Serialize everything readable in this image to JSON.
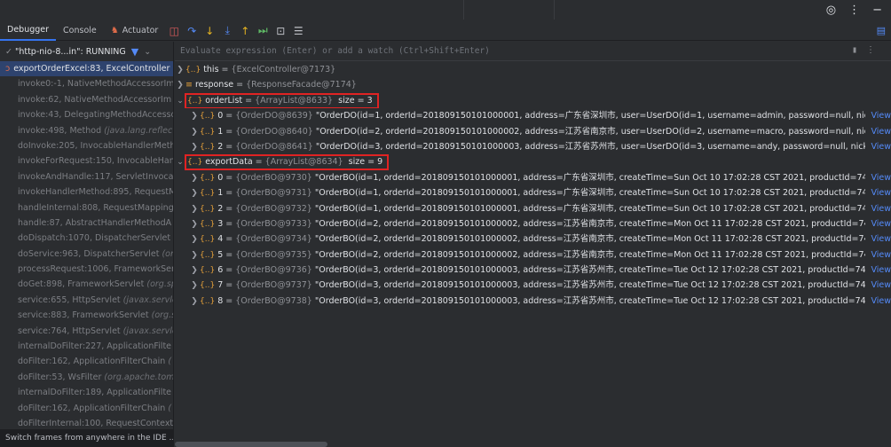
{
  "tabs": [
    {
      "label": "Debugger",
      "active": true
    },
    {
      "label": "Console",
      "active": false
    },
    {
      "label": "Actuator",
      "active": false
    }
  ],
  "thread": {
    "label": "\"http-nio-8...in\": RUNNING"
  },
  "watch": {
    "placeholder": "Evaluate expression (Enter) or add a watch (Ctrl+Shift+Enter)"
  },
  "frames": [
    {
      "text": "exportOrderExcel:83, ExcelController",
      "italic": ""
    },
    {
      "text": "invoke0:-1, NativeMethodAccessorIm",
      "italic": ""
    },
    {
      "text": "invoke:62, NativeMethodAccessorIm",
      "italic": ""
    },
    {
      "text": "invoke:43, DelegatingMethodAccesso",
      "italic": ""
    },
    {
      "text": "invoke:498, Method ",
      "italic": "(java.lang.reflect)"
    },
    {
      "text": "doInvoke:205, InvocableHandlerMeth",
      "italic": ""
    },
    {
      "text": "invokeForRequest:150, InvocableHan",
      "italic": ""
    },
    {
      "text": "invokeAndHandle:117, ServletInvocab",
      "italic": ""
    },
    {
      "text": "invokeHandlerMethod:895, RequestM",
      "italic": ""
    },
    {
      "text": "handleInternal:808, RequestMappingH",
      "italic": ""
    },
    {
      "text": "handle:87, AbstractHandlerMethodA",
      "italic": ""
    },
    {
      "text": "doDispatch:1070, DispatcherServlet ",
      "italic": "(o"
    },
    {
      "text": "doService:963, DispatcherServlet ",
      "italic": "(or"
    },
    {
      "text": "processRequest:1006, FrameworkServ",
      "italic": ""
    },
    {
      "text": "doGet:898, FrameworkServlet ",
      "italic": "(org.spr"
    },
    {
      "text": "service:655, HttpServlet ",
      "italic": "(javax.servle"
    },
    {
      "text": "service:883, FrameworkServlet ",
      "italic": "(org.s"
    },
    {
      "text": "service:764, HttpServlet ",
      "italic": "(javax.servle"
    },
    {
      "text": "internalDoFilter:227, ApplicationFilte",
      "italic": ""
    },
    {
      "text": "doFilter:162, ApplicationFilterChain ",
      "italic": "("
    },
    {
      "text": "doFilter:53, WsFilter ",
      "italic": "(org.apache.tom"
    },
    {
      "text": "internalDoFilter:189, ApplicationFilte",
      "italic": ""
    },
    {
      "text": "doFilter:162, ApplicationFilterChain ",
      "italic": "("
    },
    {
      "text": "doFilterInternal:100, RequestContextF",
      "italic": ""
    }
  ],
  "hint": "Switch frames from anywhere in the IDE ...",
  "vars": {
    "this": {
      "name": "this",
      "eq": " = ",
      "type": "{ExcelController@7173}"
    },
    "response": {
      "name": "response",
      "eq": " = ",
      "type": "{ResponseFacade@7174}"
    },
    "orderList": {
      "name": "orderList",
      "eq": " = ",
      "type": "{ArrayList@8633}",
      "size": "size = 3"
    },
    "orderItems": [
      {
        "idx": "0",
        "type": "{OrderDO@8639}",
        "str": "\"OrderDO(id=1, orderId=201809150101000001, address=广东省深圳市, user=UserDO(id=1, username=admin, password=null, nick...",
        "view": "View"
      },
      {
        "idx": "1",
        "type": "{OrderDO@8640}",
        "str": "\"OrderDO(id=2, orderId=201809150101000002, address=江苏省南京市, user=UserDO(id=2, username=macro, password=null, nick...",
        "view": "View"
      },
      {
        "idx": "2",
        "type": "{OrderDO@8641}",
        "str": "\"OrderDO(id=3, orderId=201809150101000003, address=江苏省苏州市, user=UserDO(id=3, username=andy, password=null, nickn...",
        "view": "View"
      }
    ],
    "exportData": {
      "name": "exportData",
      "eq": " = ",
      "type": "{ArrayList@8634}",
      "size": "size = 9"
    },
    "exportItems": [
      {
        "idx": "0",
        "type": "{OrderBO@9730}",
        "str": "\"OrderBO(id=1, orderId=201809150101000001, address=广东省深圳市, createTime=Sun Oct 10 17:02:28 CST 2021, productId=743 ...",
        "view": "View"
      },
      {
        "idx": "1",
        "type": "{OrderBO@9731}",
        "str": "\"OrderBO(id=1, orderId=201809150101000001, address=广东省深圳市, createTime=Sun Oct 10 17:02:28 CST 2021, productId=743 ...",
        "view": "View"
      },
      {
        "idx": "2",
        "type": "{OrderBO@9732}",
        "str": "\"OrderBO(id=1, orderId=201809150101000001, address=广东省深圳市, createTime=Sun Oct 10 17:02:28 CST 2021, productId=743 ...",
        "view": "View"
      },
      {
        "idx": "3",
        "type": "{OrderBO@9733}",
        "str": "\"OrderBO(id=2, orderId=201809150101000002, address=江苏省南京市, createTime=Mon Oct 11 17:02:28 CST 2021, productId=74...",
        "view": "View"
      },
      {
        "idx": "4",
        "type": "{OrderBO@9734}",
        "str": "\"OrderBO(id=2, orderId=201809150101000002, address=江苏省南京市, createTime=Mon Oct 11 17:02:28 CST 2021, productId=74...",
        "view": "View"
      },
      {
        "idx": "5",
        "type": "{OrderBO@9735}",
        "str": "\"OrderBO(id=2, orderId=201809150101000002, address=江苏省南京市, createTime=Mon Oct 11 17:02:28 CST 2021, productId=74...",
        "view": "View"
      },
      {
        "idx": "6",
        "type": "{OrderBO@9736}",
        "str": "\"OrderBO(id=3, orderId=201809150101000003, address=江苏省苏州市, createTime=Tue Oct 12 17:02:28 CST 2021, productId=743 ...",
        "view": "View"
      },
      {
        "idx": "7",
        "type": "{OrderBO@9737}",
        "str": "\"OrderBO(id=3, orderId=201809150101000003, address=江苏省苏州市, createTime=Tue Oct 12 17:02:28 CST 2021, productId=743 ...",
        "view": "View"
      },
      {
        "idx": "8",
        "type": "{OrderBO@9738}",
        "str": "\"OrderBO(id=3, orderId=201809150101000003, address=江苏省苏州市, createTime=Tue Oct 12 17:02:28 CST 2021, productId=743 ...",
        "view": "View"
      }
    ]
  }
}
